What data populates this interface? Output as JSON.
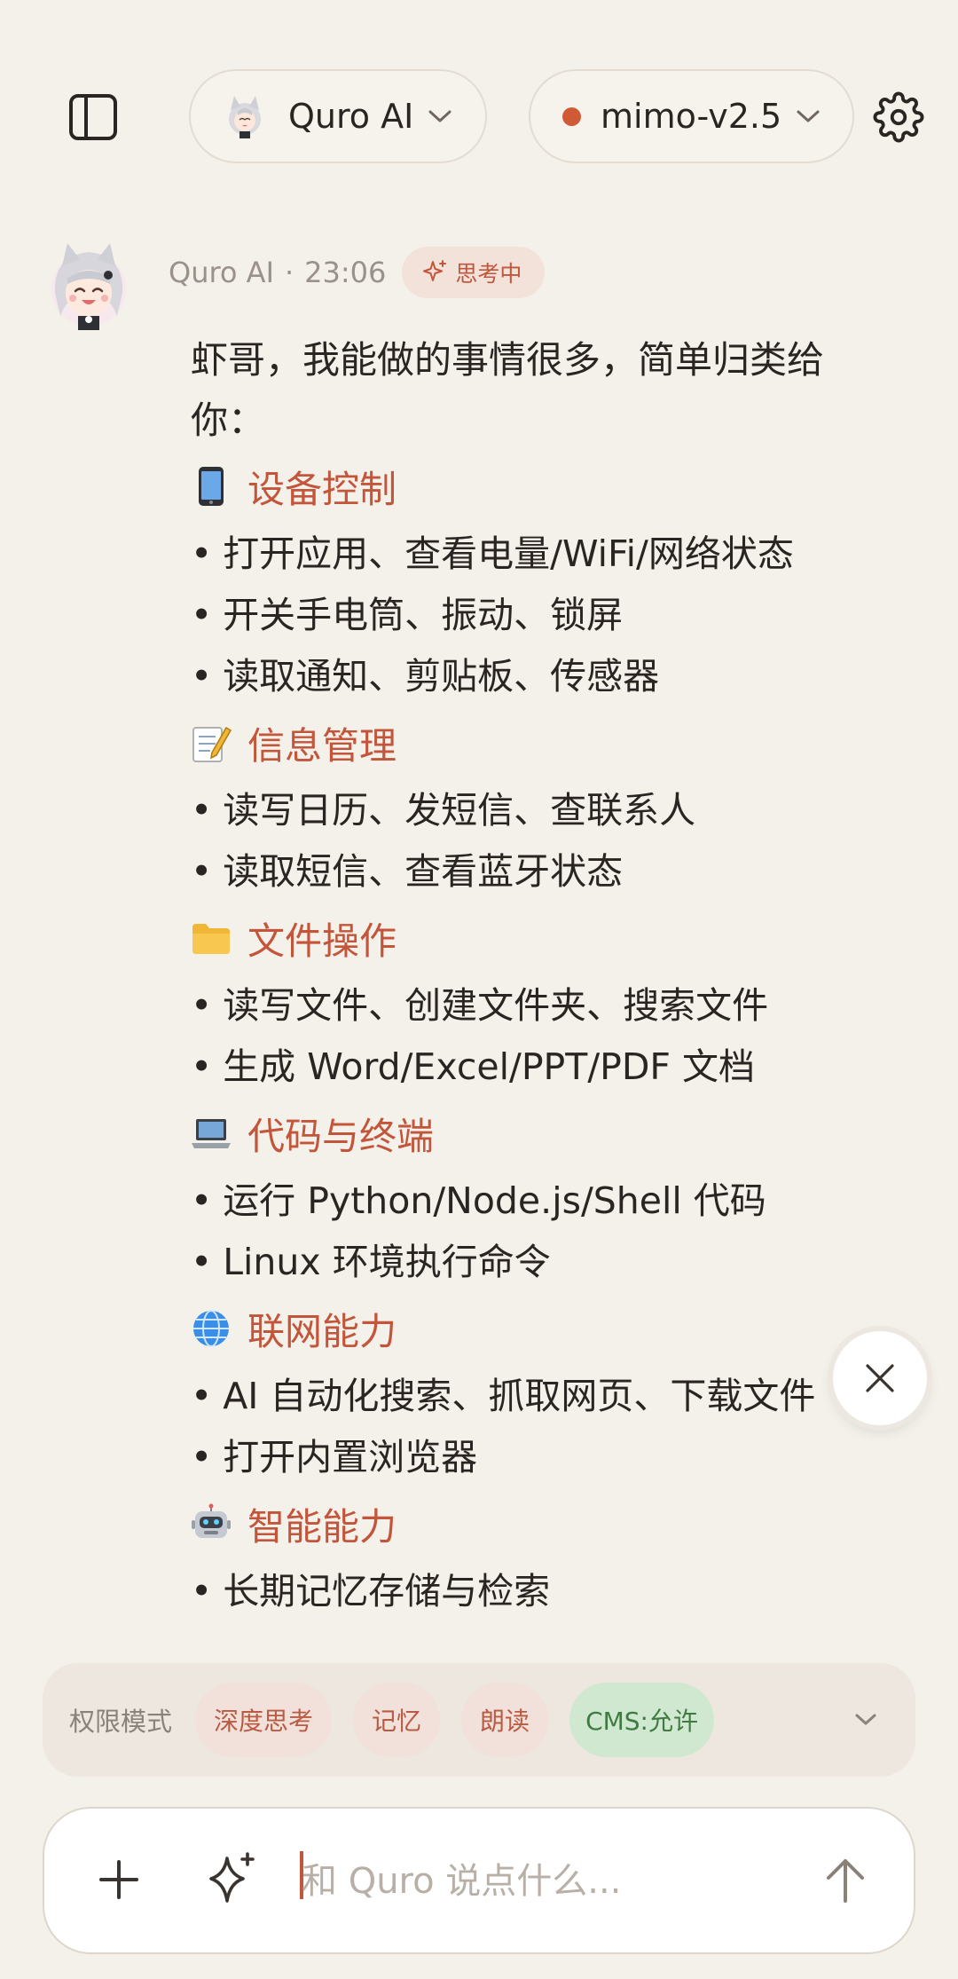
{
  "header": {
    "agent_name": "Quro AI",
    "model_name": "mimo-v2.5",
    "model_status_color": "#cf5a35"
  },
  "message": {
    "author": "Quro AI",
    "separator": "·",
    "time": "23:06",
    "status_badge": "思考中",
    "intro": "虾哥，我能做的事情很多，简单归类给你：",
    "sections": [
      {
        "emoji": "mobile-phone-icon",
        "title": "设备控制",
        "items": [
          "打开应用、查看电量/WiFi/网络状态",
          "开关手电筒、振动、锁屏",
          "读取通知、剪贴板、传感器"
        ]
      },
      {
        "emoji": "memo-icon",
        "title": "信息管理",
        "items": [
          "读写日历、发短信、查联系人",
          "读取短信、查看蓝牙状态"
        ]
      },
      {
        "emoji": "folder-icon",
        "title": "文件操作",
        "items": [
          "读写文件、创建文件夹、搜索文件",
          "生成 Word/Excel/PPT/PDF 文档"
        ]
      },
      {
        "emoji": "laptop-icon",
        "title": "代码与终端",
        "items": [
          "运行 Python/Node.js/Shell 代码",
          "Linux 环境执行命令"
        ]
      },
      {
        "emoji": "globe-icon",
        "title": "联网能力",
        "items": [
          "AI 自动化搜索、抓取网页、下载文件",
          "打开内置浏览器"
        ]
      },
      {
        "emoji": "robot-icon",
        "title": "智能能力",
        "items": [
          "长期记忆存储与检索"
        ]
      }
    ],
    "bullet_char": "•"
  },
  "options": {
    "label": "权限模式",
    "chips": [
      "深度思考",
      "记忆",
      "朗读",
      "CMS:允许"
    ]
  },
  "composer": {
    "placeholder": "和 Quro 说点什么..."
  },
  "colors": {
    "background": "#f4f0ea",
    "accent": "#c2553a",
    "chip_active_bg": "#cfe8cf",
    "chip_active_text": "#3f7a43"
  }
}
